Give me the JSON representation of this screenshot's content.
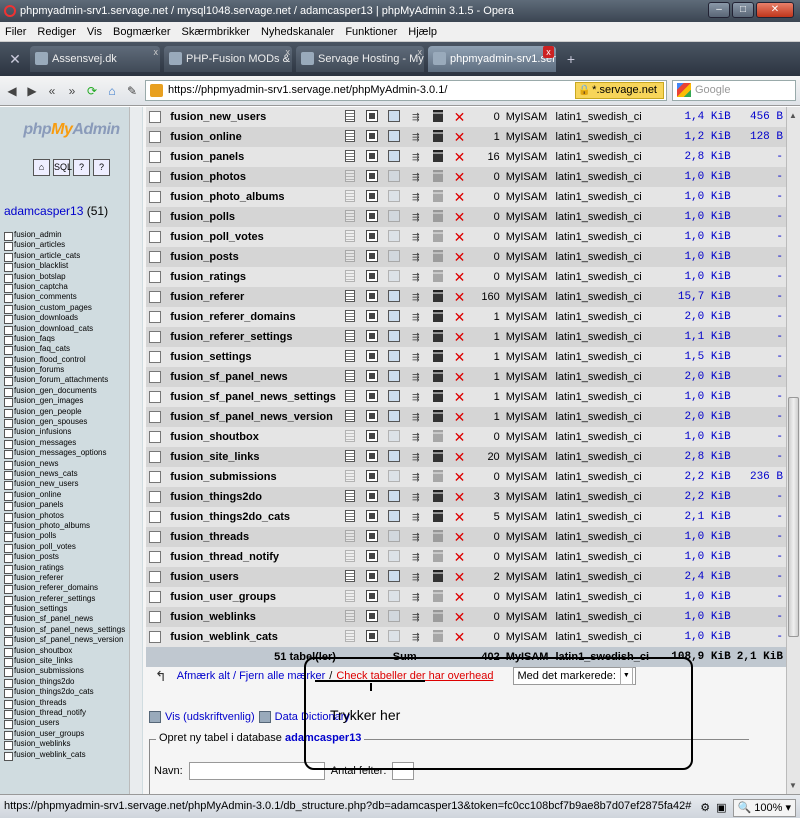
{
  "window": {
    "title": "phpmyadmin-srv1.servage.net / mysql1048.servage.net / adamcasper13 | phpMyAdmin 3.1.5 - Opera"
  },
  "menu": [
    "Filer",
    "Rediger",
    "Vis",
    "Bogmærker",
    "Skærmbrikker",
    "Nyhedskanaler",
    "Funktioner",
    "Hjælp"
  ],
  "tabs": [
    {
      "label": "Assensvej.dk",
      "active": false
    },
    {
      "label": "PHP-Fusion MODs & I...",
      "active": false
    },
    {
      "label": "Servage Hosting - MyS...",
      "active": false
    },
    {
      "label": "phpmyadmin-srv1.ser...",
      "active": true
    }
  ],
  "address": {
    "url": "https://phpmyadmin-srv1.servage.net/phpMyAdmin-3.0.1/",
    "ssl_badge": "*.servage.net",
    "search_placeholder": "Google"
  },
  "sidebar": {
    "logo_php": "php",
    "logo_my": "My",
    "logo_admin": "Admin",
    "db_name": "adamcasper13",
    "db_count": "(51)",
    "tables": [
      "fusion_admin",
      "fusion_articles",
      "fusion_article_cats",
      "fusion_blacklist",
      "fusion_botslap",
      "fusion_captcha",
      "fusion_comments",
      "fusion_custom_pages",
      "fusion_downloads",
      "fusion_download_cats",
      "fusion_faqs",
      "fusion_faq_cats",
      "fusion_flood_control",
      "fusion_forums",
      "fusion_forum_attachments",
      "fusion_gen_documents",
      "fusion_gen_images",
      "fusion_gen_people",
      "fusion_gen_spouses",
      "fusion_infusions",
      "fusion_messages",
      "fusion_messages_options",
      "fusion_news",
      "fusion_news_cats",
      "fusion_new_users",
      "fusion_online",
      "fusion_panels",
      "fusion_photos",
      "fusion_photo_albums",
      "fusion_polls",
      "fusion_poll_votes",
      "fusion_posts",
      "fusion_ratings",
      "fusion_referer",
      "fusion_referer_domains",
      "fusion_referer_settings",
      "fusion_settings",
      "fusion_sf_panel_news",
      "fusion_sf_panel_news_settings",
      "fusion_sf_panel_news_version",
      "fusion_shoutbox",
      "fusion_site_links",
      "fusion_submissions",
      "fusion_things2do",
      "fusion_things2do_cats",
      "fusion_threads",
      "fusion_thread_notify",
      "fusion_users",
      "fusion_user_groups",
      "fusion_weblinks",
      "fusion_weblink_cats"
    ]
  },
  "rows": [
    {
      "name": "fusion_new_users",
      "rows": "0",
      "engine": "MyISAM",
      "collation": "latin1_swedish_ci",
      "size": "1,4 KiB",
      "overhead": "456 B",
      "empty": false
    },
    {
      "name": "fusion_online",
      "rows": "1",
      "engine": "MyISAM",
      "collation": "latin1_swedish_ci",
      "size": "1,2 KiB",
      "overhead": "128 B",
      "empty": false
    },
    {
      "name": "fusion_panels",
      "rows": "16",
      "engine": "MyISAM",
      "collation": "latin1_swedish_ci",
      "size": "2,8 KiB",
      "overhead": "-",
      "empty": false
    },
    {
      "name": "fusion_photos",
      "rows": "0",
      "engine": "MyISAM",
      "collation": "latin1_swedish_ci",
      "size": "1,0 KiB",
      "overhead": "-",
      "empty": true
    },
    {
      "name": "fusion_photo_albums",
      "rows": "0",
      "engine": "MyISAM",
      "collation": "latin1_swedish_ci",
      "size": "1,0 KiB",
      "overhead": "-",
      "empty": true
    },
    {
      "name": "fusion_polls",
      "rows": "0",
      "engine": "MyISAM",
      "collation": "latin1_swedish_ci",
      "size": "1,0 KiB",
      "overhead": "-",
      "empty": true
    },
    {
      "name": "fusion_poll_votes",
      "rows": "0",
      "engine": "MyISAM",
      "collation": "latin1_swedish_ci",
      "size": "1,0 KiB",
      "overhead": "-",
      "empty": true
    },
    {
      "name": "fusion_posts",
      "rows": "0",
      "engine": "MyISAM",
      "collation": "latin1_swedish_ci",
      "size": "1,0 KiB",
      "overhead": "-",
      "empty": true
    },
    {
      "name": "fusion_ratings",
      "rows": "0",
      "engine": "MyISAM",
      "collation": "latin1_swedish_ci",
      "size": "1,0 KiB",
      "overhead": "-",
      "empty": true
    },
    {
      "name": "fusion_referer",
      "rows": "160",
      "engine": "MyISAM",
      "collation": "latin1_swedish_ci",
      "size": "15,7 KiB",
      "overhead": "-",
      "empty": false
    },
    {
      "name": "fusion_referer_domains",
      "rows": "1",
      "engine": "MyISAM",
      "collation": "latin1_swedish_ci",
      "size": "2,0 KiB",
      "overhead": "-",
      "empty": false
    },
    {
      "name": "fusion_referer_settings",
      "rows": "1",
      "engine": "MyISAM",
      "collation": "latin1_swedish_ci",
      "size": "1,1 KiB",
      "overhead": "-",
      "empty": false
    },
    {
      "name": "fusion_settings",
      "rows": "1",
      "engine": "MyISAM",
      "collation": "latin1_swedish_ci",
      "size": "1,5 KiB",
      "overhead": "-",
      "empty": false
    },
    {
      "name": "fusion_sf_panel_news",
      "rows": "1",
      "engine": "MyISAM",
      "collation": "latin1_swedish_ci",
      "size": "2,0 KiB",
      "overhead": "-",
      "empty": false
    },
    {
      "name": "fusion_sf_panel_news_settings",
      "rows": "1",
      "engine": "MyISAM",
      "collation": "latin1_swedish_ci",
      "size": "1,0 KiB",
      "overhead": "-",
      "empty": false
    },
    {
      "name": "fusion_sf_panel_news_version",
      "rows": "1",
      "engine": "MyISAM",
      "collation": "latin1_swedish_ci",
      "size": "2,0 KiB",
      "overhead": "-",
      "empty": false
    },
    {
      "name": "fusion_shoutbox",
      "rows": "0",
      "engine": "MyISAM",
      "collation": "latin1_swedish_ci",
      "size": "1,0 KiB",
      "overhead": "-",
      "empty": true
    },
    {
      "name": "fusion_site_links",
      "rows": "20",
      "engine": "MyISAM",
      "collation": "latin1_swedish_ci",
      "size": "2,8 KiB",
      "overhead": "-",
      "empty": false
    },
    {
      "name": "fusion_submissions",
      "rows": "0",
      "engine": "MyISAM",
      "collation": "latin1_swedish_ci",
      "size": "2,2 KiB",
      "overhead": "236 B",
      "empty": true
    },
    {
      "name": "fusion_things2do",
      "rows": "3",
      "engine": "MyISAM",
      "collation": "latin1_swedish_ci",
      "size": "2,2 KiB",
      "overhead": "-",
      "empty": false
    },
    {
      "name": "fusion_things2do_cats",
      "rows": "5",
      "engine": "MyISAM",
      "collation": "latin1_swedish_ci",
      "size": "2,1 KiB",
      "overhead": "-",
      "empty": false
    },
    {
      "name": "fusion_threads",
      "rows": "0",
      "engine": "MyISAM",
      "collation": "latin1_swedish_ci",
      "size": "1,0 KiB",
      "overhead": "-",
      "empty": true
    },
    {
      "name": "fusion_thread_notify",
      "rows": "0",
      "engine": "MyISAM",
      "collation": "latin1_swedish_ci",
      "size": "1,0 KiB",
      "overhead": "-",
      "empty": true
    },
    {
      "name": "fusion_users",
      "rows": "2",
      "engine": "MyISAM",
      "collation": "latin1_swedish_ci",
      "size": "2,4 KiB",
      "overhead": "-",
      "empty": false
    },
    {
      "name": "fusion_user_groups",
      "rows": "0",
      "engine": "MyISAM",
      "collation": "latin1_swedish_ci",
      "size": "1,0 KiB",
      "overhead": "-",
      "empty": true
    },
    {
      "name": "fusion_weblinks",
      "rows": "0",
      "engine": "MyISAM",
      "collation": "latin1_swedish_ci",
      "size": "1,0 KiB",
      "overhead": "-",
      "empty": true
    },
    {
      "name": "fusion_weblink_cats",
      "rows": "0",
      "engine": "MyISAM",
      "collation": "latin1_swedish_ci",
      "size": "1,0 KiB",
      "overhead": "-",
      "empty": true
    }
  ],
  "summary": {
    "tables": "51 tabel(ler)",
    "sum": "Sum",
    "rows": "402",
    "engine": "MyISAM",
    "collation": "latin1_swedish_ci",
    "size": "108,9 KiB",
    "overhead": "2,1 KiB"
  },
  "actions": {
    "check_all": "Afmærk alt / Fjern alle mærker",
    "sep": "/",
    "check_overhead": "Check tabeller der har overhead",
    "with_selected": "Med det markerede:"
  },
  "print_links": {
    "print": "Vis (udskriftvenlig)",
    "dictionary": "Data Dictionary"
  },
  "create_table": {
    "legend": "Opret ny tabel i database",
    "db": "adamcasper13",
    "name_label": "Navn:",
    "fields_label": "Antal felter:"
  },
  "annotation": {
    "text": "Trykker her"
  },
  "status": {
    "url": "https://phpmyadmin-srv1.servage.net/phpMyAdmin-3.0.1/db_structure.php?db=adamcasper13&token=fc0cc108bcf7b9ae8b7d07ef2875fa42#",
    "zoom": "100%"
  },
  "colors": {
    "accent": "#0000cc",
    "drop": "#dd0000",
    "row_odd": "#e5e5e5",
    "row_even": "#d5d5d5"
  }
}
